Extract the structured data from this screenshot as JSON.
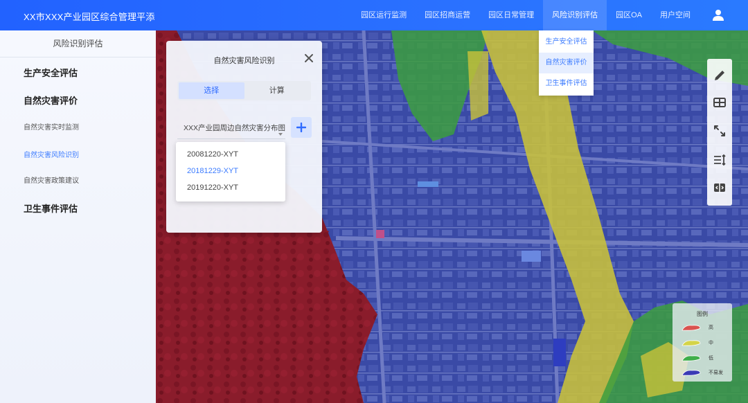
{
  "header": {
    "title": "XX市XXX产业园区综合管理平添",
    "nav": [
      "园区运行监测",
      "园区招商运营",
      "园区日常管理",
      "风险识别评估",
      "园区OA",
      "用户空间"
    ],
    "active_nav_index": 3,
    "user_icon": "user-icon"
  },
  "nav_dropdown": {
    "items": [
      "生产安全评估",
      "自然灾害评价",
      "卫生事件评估"
    ],
    "active_index": 1
  },
  "sidebar": {
    "header": "风险识别评估",
    "sections": [
      {
        "label": "生产安全评估",
        "items": []
      },
      {
        "label": "自然灾害评价",
        "items": [
          "自然灾害实时监测",
          "自然灾害风险识别",
          "自然灾害政策建议"
        ],
        "active_item": 1
      },
      {
        "label": "卫生事件评估",
        "items": []
      }
    ]
  },
  "panel": {
    "title": "自然灾害风险识别",
    "close_icon": "close-icon",
    "tabs": [
      "选择",
      "计算"
    ],
    "active_tab": 0,
    "select_value": "XXX产业园周边自然灾害分布图",
    "add_icon": "plus-icon",
    "options": [
      "20081220-XYT",
      "20181229-XYT",
      "20191220-XYT"
    ],
    "selected_option": 1
  },
  "toolbar": {
    "icons": [
      "pencil-icon",
      "table-icon",
      "expand-icon",
      "list-sort-icon",
      "compare-icon"
    ]
  },
  "legend": {
    "title": "图例",
    "items": [
      {
        "label": "高",
        "color": "#d9534f"
      },
      {
        "label": "中",
        "color": "#d4d449"
      },
      {
        "label": "低",
        "color": "#3fae4a"
      },
      {
        "label": "不易发",
        "color": "#3b3bb5"
      }
    ]
  },
  "colors": {
    "accent": "#2f6bff",
    "high_risk": "#8b1a2a",
    "medium_risk": "#c9c23a",
    "low_risk": "#3c9d3e",
    "not_prone": "#3a47a8"
  }
}
